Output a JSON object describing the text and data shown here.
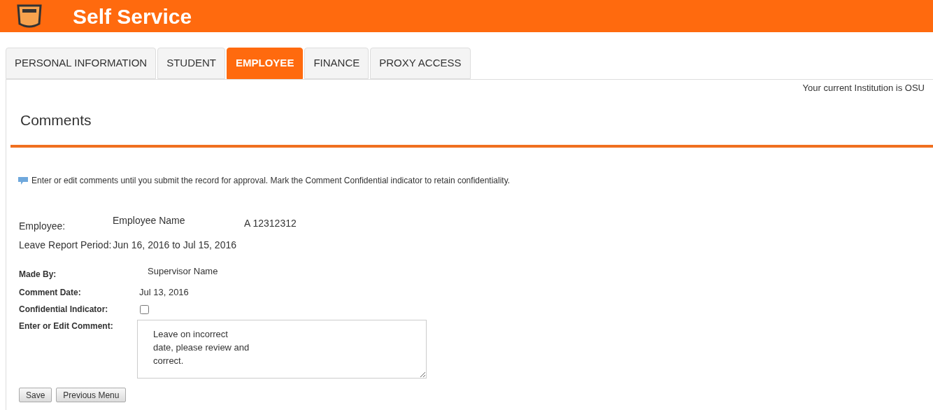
{
  "header": {
    "title": "Self Service"
  },
  "tabs": [
    {
      "label": "PERSONAL INFORMATION",
      "selected": false
    },
    {
      "label": "STUDENT",
      "selected": false
    },
    {
      "label": "EMPLOYEE",
      "selected": true
    },
    {
      "label": "FINANCE",
      "selected": false
    },
    {
      "label": "PROXY ACCESS",
      "selected": false
    }
  ],
  "institution": "Your current Institution is OSU",
  "page_title": "Comments",
  "info": "Enter or edit comments until you submit the record for approval. Mark the Comment Confidential indicator to retain confidentiality.",
  "employee": {
    "label": "Employee:",
    "name": "Employee Name",
    "id": "A 12312312"
  },
  "period": {
    "label": "Leave Report Period:",
    "value": "Jun 16, 2016 to Jul 15, 2016"
  },
  "made_by": {
    "label": "Made By:",
    "value": "Supervisor Name"
  },
  "comment_date": {
    "label": "Comment Date:",
    "value": "Jul 13, 2016"
  },
  "confidential": {
    "label": "Confidential Indicator:",
    "checked": false
  },
  "comment": {
    "label": "Enter or Edit Comment:",
    "value": "Leave on incorrect\ndate, please review and\ncorrect."
  },
  "buttons": [
    "Save",
    "Previous Menu"
  ]
}
